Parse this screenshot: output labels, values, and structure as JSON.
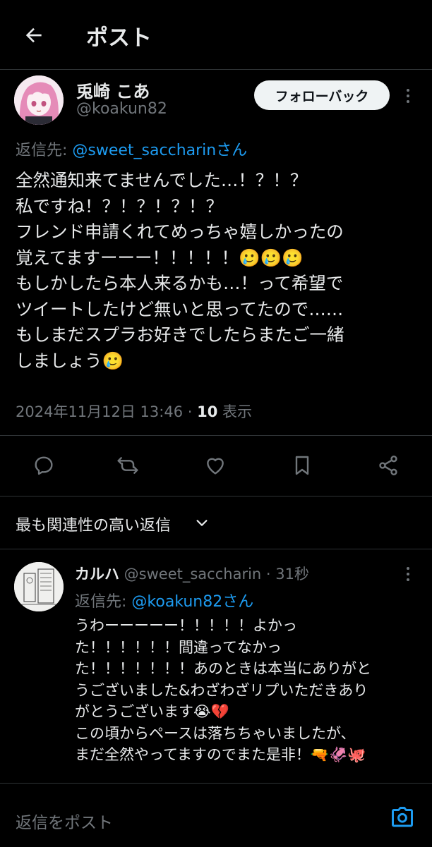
{
  "header": {
    "title": "ポスト"
  },
  "post": {
    "author_name": "兎崎 こあ",
    "author_handle": "@koakun82",
    "follow_label": "フォローバック",
    "reply_to_prefix": "返信先: ",
    "reply_to_mention": "@sweet_saccharinさん",
    "lines": [
      "全然通知来てませんでした…！？！？",
      "私ですね！？！？！？！？",
      "フレンド申請くれてめっちゃ嬉しかったの",
      "覚えてますーーー！！！！！🥲🥲🥲",
      "もしかしたら本人来るかも…！って希望で",
      "ツイートしたけど無いと思ってたので……",
      "もしまだスプラお好きでしたらまたご一緒",
      "しましょう🥲"
    ],
    "timestamp": "2024年11月12日 13:46",
    "separator": " · ",
    "views_count": "10",
    "views_label": " 表示"
  },
  "actions": {
    "icons": [
      "reply-icon",
      "repost-icon",
      "like-icon",
      "bookmark-icon",
      "share-icon"
    ]
  },
  "replies_section": {
    "sort_label": "最も関連性の高い返信"
  },
  "reply": {
    "author_name": "カルハ",
    "author_handle": " @sweet_saccharin",
    "time": " · 31秒",
    "reply_to_prefix": "返信先: ",
    "reply_to_mention": "@koakun82さん",
    "lines": [
      "うわーーーーー！！！！！よかっ",
      "た！！！！！！間違ってなかっ",
      "た！！！！！！！あのときは本当にありがと",
      "うございました&わざわざリプいただきあり",
      "がとうございます😭💔",
      "この頃からペースは落ちちゃいましたが、",
      "まだ全然やってますのでまた是非！🔫🦑🐙"
    ]
  },
  "composer": {
    "placeholder": "返信をポスト"
  },
  "colors": {
    "background": "#000000",
    "text": "#e7e9ea",
    "muted": "#71767b",
    "accent": "#1d9bf0",
    "divider": "#2f3336"
  }
}
